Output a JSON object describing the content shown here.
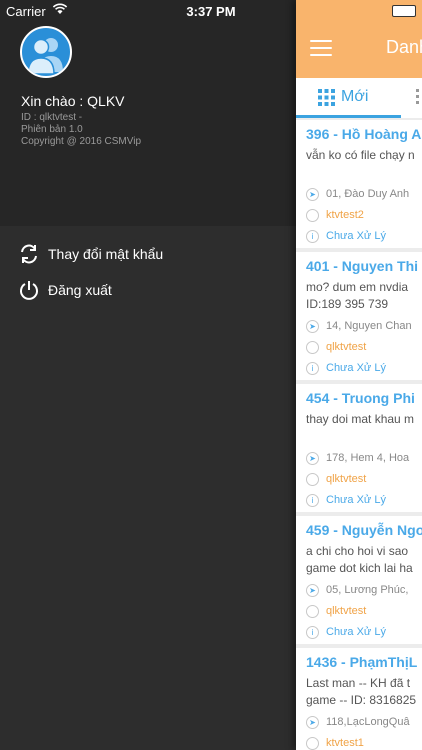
{
  "status_bar": {
    "carrier": "Carrier",
    "time": "3:37 PM"
  },
  "drawer": {
    "greeting": "Xin chào : QLKV",
    "id_line": "ID : qlktvtest -",
    "version": "Phiên bản 1.0",
    "copyright": "Copyright @ 2016 CSMVip",
    "menu": [
      {
        "label": "Thay đổi mật khẩu",
        "icon": "refresh-icon"
      },
      {
        "label": "Đăng xuất",
        "icon": "power-icon"
      }
    ]
  },
  "header": {
    "title": "Danh"
  },
  "tabs": [
    {
      "label": "Mới",
      "icon": "grid-icon",
      "active": true
    }
  ],
  "tickets": [
    {
      "title": "396 - Hồ Hoàng A",
      "desc": [
        "vẫn ko có file chạy n"
      ],
      "address": "01, Đào Duy Anh",
      "user": "ktvtest2",
      "status": "Chưa Xử Lý"
    },
    {
      "title": "401 - Nguyen Thi",
      "desc": [
        "mo? dum em nvdia",
        "ID:189 395 739"
      ],
      "address": "14, Nguyen Chan",
      "user": "qlktvtest",
      "status": "Chưa Xử Lý"
    },
    {
      "title": "454 - Truong Phi",
      "desc": [
        "thay doi mat khau m"
      ],
      "address": "178, Hem 4, Hoa",
      "user": "qlktvtest",
      "status": "Chưa Xử Lý"
    },
    {
      "title": "459 - Nguyễn Ngo",
      "desc": [
        "a chi cho hoi vi sao",
        "game dot kich lai ha"
      ],
      "address": "05, Lương Phúc,",
      "user": "qlktvtest",
      "status": "Chưa Xử Lý"
    },
    {
      "title": "1436 - PhạmThịL",
      "desc": [
        "Last man -- KH đã t",
        "game -- ID: 8316825"
      ],
      "address": "118,LạcLongQuâ",
      "user": "ktvtest1",
      "status": ""
    }
  ],
  "colors": {
    "accent": "#3ba3e0",
    "header": "#f9b46c",
    "user_text": "#f0a347",
    "drawer_bg": "#2d2d2d"
  }
}
